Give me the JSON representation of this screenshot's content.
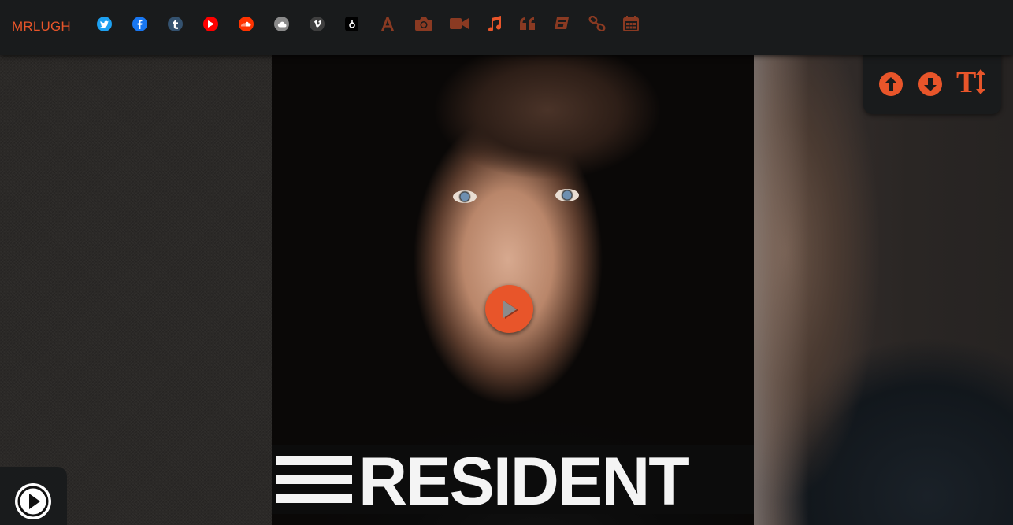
{
  "header": {
    "brand": "MRLUGH",
    "social_links": [
      {
        "name": "twitter-icon",
        "color": "#1da1f2",
        "glyph": "t"
      },
      {
        "name": "facebook-icon",
        "color": "#1877f2",
        "glyph": "f"
      },
      {
        "name": "tumblr-icon",
        "color": "#34526f",
        "glyph": "t"
      },
      {
        "name": "youtube-icon",
        "color": "#ff0000",
        "glyph": "▶"
      },
      {
        "name": "soundcloud-icon",
        "color": "#ff3300",
        "glyph": "☁"
      },
      {
        "name": "mixcloud-icon",
        "color": "#888888",
        "glyph": "☁"
      },
      {
        "name": "vimeo-icon",
        "color": "#444444",
        "glyph": "v"
      },
      {
        "name": "beatport-icon",
        "color": "#000000",
        "glyph": "b"
      }
    ],
    "post_types": [
      {
        "name": "text-post-icon",
        "active": false
      },
      {
        "name": "photo-post-icon",
        "active": false
      },
      {
        "name": "video-post-icon",
        "active": false
      },
      {
        "name": "audio-post-icon",
        "active": true
      },
      {
        "name": "quote-post-icon",
        "active": false
      },
      {
        "name": "chat-post-icon",
        "active": false
      },
      {
        "name": "link-post-icon",
        "active": false
      },
      {
        "name": "archive-calendar-icon",
        "active": false
      }
    ]
  },
  "artwork": {
    "banner_text": "RESIDENT"
  },
  "controls": {
    "text_size_label": "T"
  },
  "colors": {
    "accent": "#e8552a",
    "accent_dim": "#8a3a22",
    "bar": "#191b1c"
  }
}
